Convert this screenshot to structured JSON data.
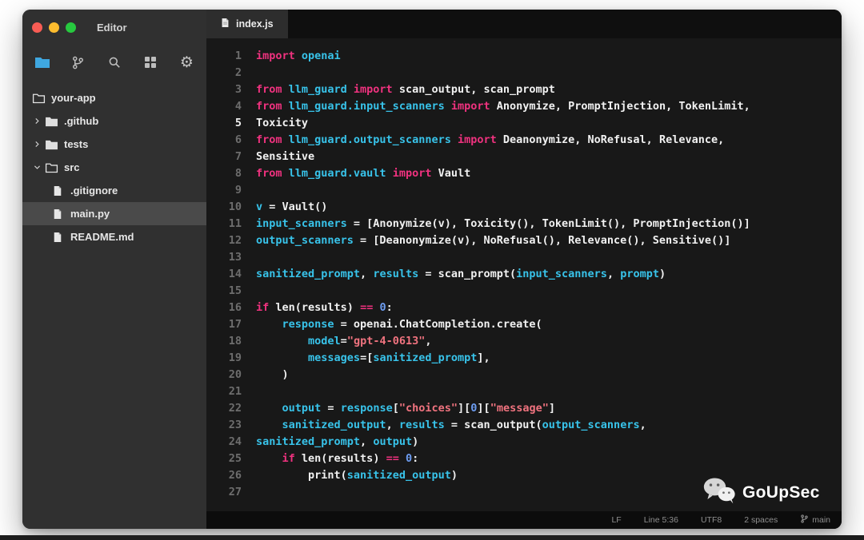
{
  "window": {
    "title": "Editor",
    "traffic_lights": [
      "#f85c54",
      "#fdbc2e",
      "#27c93f"
    ]
  },
  "sidebar": {
    "toolbar": [
      {
        "icon": "files",
        "name": "files-icon",
        "active": true
      },
      {
        "icon": "git-branch",
        "name": "git-branch-icon"
      },
      {
        "icon": "search",
        "name": "search-icon"
      },
      {
        "icon": "extensions",
        "name": "extensions-icon"
      },
      {
        "icon": "gear",
        "name": "settings-icon"
      }
    ],
    "tree": [
      {
        "label": "your-app",
        "depth": 0,
        "icon": "folder-open",
        "chevron": null,
        "type": "folder"
      },
      {
        "label": ".github",
        "depth": 1,
        "icon": "folder-closed",
        "chevron": "right",
        "type": "folder"
      },
      {
        "label": "tests",
        "depth": 1,
        "icon": "folder-closed",
        "chevron": "right",
        "type": "folder"
      },
      {
        "label": "src",
        "depth": 1,
        "icon": "folder-open",
        "chevron": "down",
        "type": "folder"
      },
      {
        "label": ".gitignore",
        "depth": 2,
        "icon": "file",
        "chevron": null,
        "type": "file"
      },
      {
        "label": "main.py",
        "depth": 2,
        "icon": "file",
        "chevron": null,
        "type": "file",
        "selected": true
      },
      {
        "label": "README.md",
        "depth": 2,
        "icon": "file",
        "chevron": null,
        "type": "file"
      }
    ]
  },
  "tabs": [
    {
      "label": "index.js",
      "active": true
    }
  ],
  "editor": {
    "current_line": 5,
    "lines": [
      {
        "n": 1,
        "tokens": [
          {
            "t": "import",
            "c": "kw"
          },
          {
            "t": " openai",
            "c": "name"
          }
        ]
      },
      {
        "n": 2,
        "tokens": []
      },
      {
        "n": 3,
        "tokens": [
          {
            "t": "from",
            "c": "kw"
          },
          {
            "t": " llm_guard ",
            "c": "name"
          },
          {
            "t": "import",
            "c": "kw"
          },
          {
            "t": " scan_output, scan_prompt",
            "c": "plain"
          }
        ]
      },
      {
        "n": 4,
        "tokens": [
          {
            "t": "from",
            "c": "kw"
          },
          {
            "t": " llm_guard.input_scanners ",
            "c": "name"
          },
          {
            "t": "import",
            "c": "kw"
          },
          {
            "t": " Anonymize, PromptInjection, TokenLimit,",
            "c": "plain"
          }
        ]
      },
      {
        "n": 5,
        "tokens": [
          {
            "t": "Toxicity",
            "c": "plain"
          }
        ]
      },
      {
        "n": 6,
        "tokens": [
          {
            "t": "from",
            "c": "kw"
          },
          {
            "t": " llm_guard.output_scanners ",
            "c": "name"
          },
          {
            "t": "import",
            "c": "kw"
          },
          {
            "t": " Deanonymize, NoRefusal, Relevance,",
            "c": "plain"
          }
        ]
      },
      {
        "n": 7,
        "tokens": [
          {
            "t": "Sensitive",
            "c": "plain"
          }
        ]
      },
      {
        "n": 8,
        "tokens": [
          {
            "t": "from",
            "c": "kw"
          },
          {
            "t": " llm_guard.vault ",
            "c": "name"
          },
          {
            "t": "import",
            "c": "kw"
          },
          {
            "t": " Vault",
            "c": "plain"
          }
        ]
      },
      {
        "n": 9,
        "tokens": []
      },
      {
        "n": 10,
        "tokens": [
          {
            "t": "v",
            "c": "name"
          },
          {
            "t": " = Vault()",
            "c": "plain"
          }
        ]
      },
      {
        "n": 11,
        "tokens": [
          {
            "t": "input_scanners",
            "c": "name"
          },
          {
            "t": " = [Anonymize(v), Toxicity(), TokenLimit(), PromptInjection()]",
            "c": "plain"
          }
        ]
      },
      {
        "n": 12,
        "tokens": [
          {
            "t": "output_scanners",
            "c": "name"
          },
          {
            "t": " = [Deanonymize(v), NoRefusal(), Relevance(), Sensitive()]",
            "c": "plain"
          }
        ]
      },
      {
        "n": 13,
        "tokens": []
      },
      {
        "n": 14,
        "tokens": [
          {
            "t": "sanitized_prompt",
            "c": "name"
          },
          {
            "t": ", ",
            "c": "plain"
          },
          {
            "t": "results",
            "c": "name"
          },
          {
            "t": " = scan_prompt(",
            "c": "plain"
          },
          {
            "t": "input_scanners",
            "c": "name"
          },
          {
            "t": ", ",
            "c": "plain"
          },
          {
            "t": "prompt",
            "c": "name"
          },
          {
            "t": ")",
            "c": "plain"
          }
        ]
      },
      {
        "n": 15,
        "tokens": []
      },
      {
        "n": 16,
        "tokens": [
          {
            "t": "if",
            "c": "kw"
          },
          {
            "t": " len(results) ",
            "c": "plain"
          },
          {
            "t": "==",
            "c": "kw"
          },
          {
            "t": " ",
            "c": "plain"
          },
          {
            "t": "0",
            "c": "num"
          },
          {
            "t": ":",
            "c": "plain"
          }
        ]
      },
      {
        "n": 17,
        "tokens": [
          {
            "t": "    ",
            "c": "plain"
          },
          {
            "t": "response",
            "c": "name"
          },
          {
            "t": " = openai.ChatCompletion.create(",
            "c": "plain"
          }
        ]
      },
      {
        "n": 18,
        "tokens": [
          {
            "t": "        ",
            "c": "plain"
          },
          {
            "t": "model",
            "c": "name"
          },
          {
            "t": "=",
            "c": "plain"
          },
          {
            "t": "\"gpt-4-0613\"",
            "c": "str"
          },
          {
            "t": ",",
            "c": "plain"
          }
        ]
      },
      {
        "n": 19,
        "tokens": [
          {
            "t": "        ",
            "c": "plain"
          },
          {
            "t": "messages",
            "c": "name"
          },
          {
            "t": "=[",
            "c": "plain"
          },
          {
            "t": "sanitized_prompt",
            "c": "name"
          },
          {
            "t": "],",
            "c": "plain"
          }
        ]
      },
      {
        "n": 20,
        "tokens": [
          {
            "t": "    )",
            "c": "plain"
          }
        ]
      },
      {
        "n": 21,
        "tokens": []
      },
      {
        "n": 22,
        "tokens": [
          {
            "t": "    ",
            "c": "plain"
          },
          {
            "t": "output",
            "c": "name"
          },
          {
            "t": " = ",
            "c": "plain"
          },
          {
            "t": "response",
            "c": "name"
          },
          {
            "t": "[",
            "c": "plain"
          },
          {
            "t": "\"choices\"",
            "c": "str"
          },
          {
            "t": "][",
            "c": "plain"
          },
          {
            "t": "0",
            "c": "num"
          },
          {
            "t": "][",
            "c": "plain"
          },
          {
            "t": "\"message\"",
            "c": "str"
          },
          {
            "t": "]",
            "c": "plain"
          }
        ]
      },
      {
        "n": 23,
        "tokens": [
          {
            "t": "    ",
            "c": "plain"
          },
          {
            "t": "sanitized_output",
            "c": "name"
          },
          {
            "t": ", ",
            "c": "plain"
          },
          {
            "t": "results",
            "c": "name"
          },
          {
            "t": " = scan_output(",
            "c": "plain"
          },
          {
            "t": "output_scanners",
            "c": "name"
          },
          {
            "t": ",",
            "c": "plain"
          }
        ]
      },
      {
        "n": 24,
        "tokens": [
          {
            "t": "sanitized_prompt",
            "c": "name"
          },
          {
            "t": ", ",
            "c": "plain"
          },
          {
            "t": "output",
            "c": "name"
          },
          {
            "t": ")",
            "c": "plain"
          }
        ]
      },
      {
        "n": 25,
        "tokens": [
          {
            "t": "    ",
            "c": "plain"
          },
          {
            "t": "if",
            "c": "kw"
          },
          {
            "t": " len(results) ",
            "c": "plain"
          },
          {
            "t": "==",
            "c": "kw"
          },
          {
            "t": " ",
            "c": "plain"
          },
          {
            "t": "0",
            "c": "num"
          },
          {
            "t": ":",
            "c": "plain"
          }
        ]
      },
      {
        "n": 26,
        "tokens": [
          {
            "t": "        print(",
            "c": "plain"
          },
          {
            "t": "sanitized_output",
            "c": "name"
          },
          {
            "t": ")",
            "c": "plain"
          }
        ]
      },
      {
        "n": 27,
        "tokens": []
      }
    ]
  },
  "status_bar": {
    "items": [
      {
        "label": "LF"
      },
      {
        "label": "Line 5:36"
      },
      {
        "label": "UTF8"
      },
      {
        "label": "2 spaces"
      },
      {
        "label": "main",
        "icon": "git-branch"
      }
    ]
  },
  "watermark": {
    "text": "GoUpSec",
    "icon": "wechat"
  },
  "colors": {
    "sidebar_bg": "#303030",
    "editor_bg": "#181818",
    "tab_bg": "#2d2d2d",
    "tabbar_bg": "#0f0f0f",
    "statusbar_bg": "#0c0c0c",
    "selected_row": "#4a4a4a",
    "accent_blue": "#3fa7e0",
    "syntax_keyword": "#f0327f",
    "syntax_name": "#38c3ea",
    "syntax_string": "#f0737f",
    "syntax_number": "#6d9df2",
    "syntax_plain": "#f1f1f1"
  }
}
